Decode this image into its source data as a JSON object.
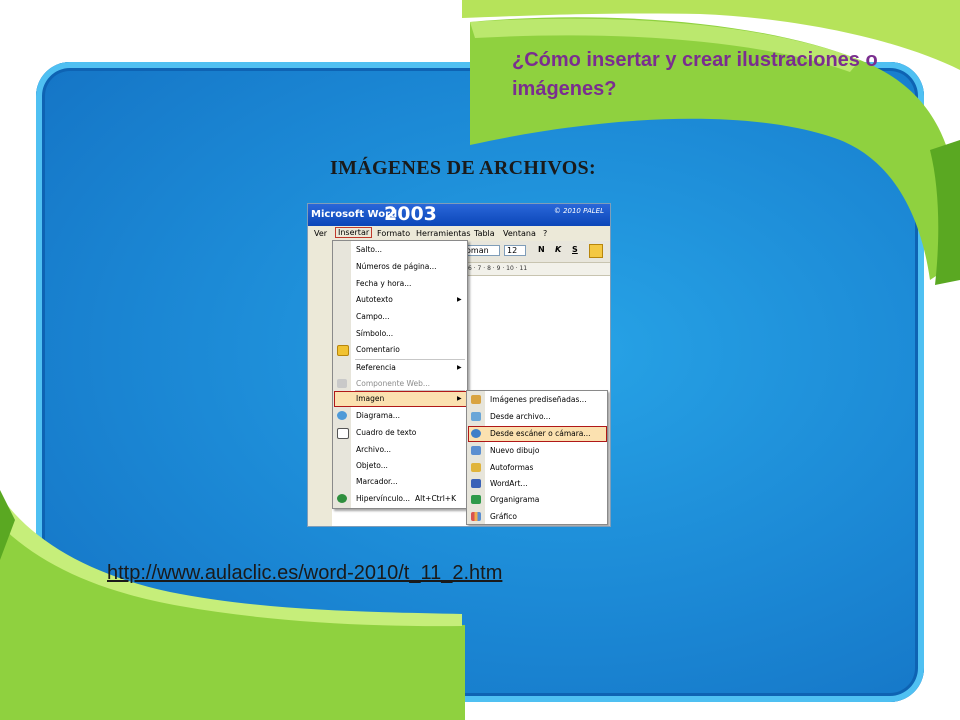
{
  "slide": {
    "title": "¿Cómo insertar y crear ilustraciones o imágenes?",
    "subtitle": "IMÁGENES DE ARCHIVOS:",
    "link": "http://www.aulaclic.es/word-2010/t_11_2.htm",
    "colors": {
      "background": "#1b87d4",
      "ribbon": "#8fd13f",
      "title": "#7a2e8f"
    }
  },
  "screenshot": {
    "app_name": "Microsoft Word",
    "version": "2003",
    "credit": "© 2010 PALEL",
    "menubar": [
      "Ver",
      "Insertar",
      "Formato",
      "Herramientas",
      "Tabla",
      "Ventana",
      "?"
    ],
    "toolbar": {
      "font": "oman",
      "size": "12",
      "bold": "N",
      "italic": "K",
      "underline": "S"
    },
    "ruler": "6 · 7 · 8 · 9 · 10 · 11",
    "insert_menu": [
      {
        "label": "Salto...",
        "icon": "none"
      },
      {
        "label": "Números de página...",
        "icon": "none"
      },
      {
        "label": "Fecha y hora...",
        "icon": "none"
      },
      {
        "label": "Autotexto",
        "icon": "none",
        "submenu": true
      },
      {
        "label": "Campo...",
        "icon": "none"
      },
      {
        "label": "Símbolo...",
        "icon": "none"
      },
      {
        "label": "Comentario",
        "icon": "comment-icon"
      },
      {
        "label": "Referencia",
        "icon": "none",
        "submenu": true
      },
      {
        "label": "Componente Web...",
        "icon": "web-component-icon",
        "disabled": true
      },
      {
        "label": "Imagen",
        "icon": "none",
        "submenu": true,
        "highlighted": true
      },
      {
        "label": "Diagrama...",
        "icon": "diagram-icon"
      },
      {
        "label": "Cuadro de texto",
        "icon": "textbox-icon"
      },
      {
        "label": "Archivo...",
        "icon": "none"
      },
      {
        "label": "Objeto...",
        "icon": "none"
      },
      {
        "label": "Marcador...",
        "icon": "none"
      },
      {
        "label": "Hipervínculo...",
        "icon": "hyperlink-icon",
        "shortcut": "Alt+Ctrl+K"
      }
    ],
    "image_submenu": [
      {
        "label": "Imágenes prediseñadas...",
        "icon": "clipart-icon"
      },
      {
        "label": "Desde archivo...",
        "icon": "picture-file-icon"
      },
      {
        "label": "Desde escáner o cámara...",
        "icon": "scanner-icon",
        "highlighted": true
      },
      {
        "label": "Nuevo dibujo",
        "icon": "drawing-icon"
      },
      {
        "label": "Autoformas",
        "icon": "autoshapes-icon"
      },
      {
        "label": "WordArt...",
        "icon": "wordart-icon"
      },
      {
        "label": "Organigrama",
        "icon": "orgchart-icon"
      },
      {
        "label": "Gráfico",
        "icon": "chart-icon"
      }
    ]
  }
}
